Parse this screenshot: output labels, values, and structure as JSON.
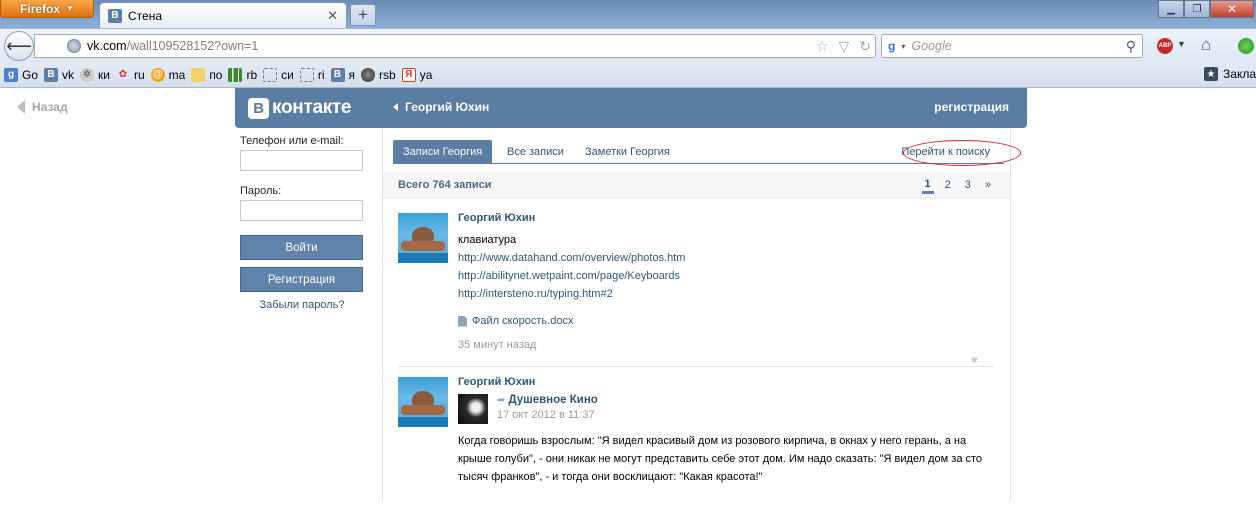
{
  "browser": {
    "menu_button": "Firefox",
    "tab_title": "Стена",
    "tab_favicon": "В",
    "url_domain": "vk.com",
    "url_path": "/wall109528152?own=1",
    "search_engine": "Google",
    "search_placeholder": "Google",
    "bookmarks": [
      {
        "icon": "google-icon",
        "label": "Go"
      },
      {
        "icon": "vk-icon",
        "label": "vk"
      },
      {
        "icon": "film-icon",
        "label": "ки"
      },
      {
        "icon": "flower-icon",
        "label": "ru"
      },
      {
        "icon": "mail-icon",
        "label": "ma"
      },
      {
        "icon": "folder-icon",
        "label": "по"
      },
      {
        "icon": "chart-icon",
        "label": "rb"
      },
      {
        "icon": "page-icon",
        "label": "си"
      },
      {
        "icon": "page-icon",
        "label": "ri"
      },
      {
        "icon": "vk-icon",
        "label": "я"
      },
      {
        "icon": "globe-icon",
        "label": "rsb"
      },
      {
        "icon": "yandex-icon",
        "label": "ya"
      }
    ],
    "bookmarks_menu": "Закла"
  },
  "page": {
    "back_label": "Назад",
    "logo_text": "контакте",
    "logo_letter": "В",
    "owner_name": "Георгий Юхин",
    "register_link": "регистрация"
  },
  "login": {
    "phone_label": "Телефон или e-mail:",
    "password_label": "Пароль:",
    "login_button": "Войти",
    "register_button": "Регистрация",
    "forgot_link": "Забыли пароль?"
  },
  "wall": {
    "tabs": [
      "Записи Георгия",
      "Все записи",
      "Заметки Георгия"
    ],
    "search_link": "Перейти к поиску",
    "summary": "Всего 764 записи",
    "pager": [
      "1",
      "2",
      "3",
      "»"
    ],
    "posts": [
      {
        "author": "Георгий Юхин",
        "text": "клавиатура",
        "links": [
          "http://www.datahand.com/overview/photos.htm",
          "http://abilitynet.wetpaint.com/page/Keyboards",
          "http://intersteno.ru/typing.htm#2"
        ],
        "attachment": "Файл скорость.docx",
        "time": "35 минут назад"
      },
      {
        "author": "Георгий Юхин",
        "repost_from": "Душевное Кино",
        "repost_date": "17 окт 2012 в 11:37",
        "quote": "Когда говоришь взрослым: \"Я видел красивый дом из розового кирпича, в окнах у него герань, а на крыше голуби\", - они никак не могут представить себе этот дом. Им надо сказать: \"Я видел дом за сто тысяч франков\", - и тогда они восклицают: \"Какая красота!\""
      }
    ]
  }
}
